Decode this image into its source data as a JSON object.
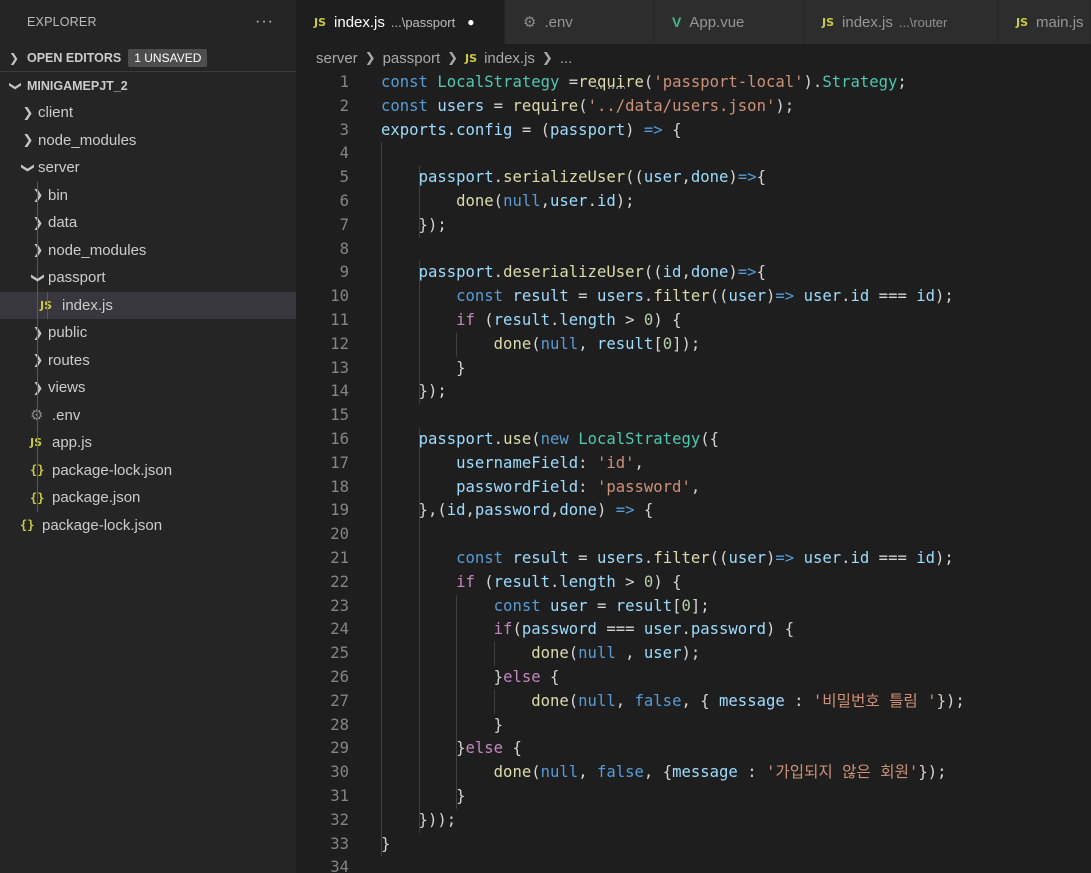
{
  "sidebar": {
    "title": "EXPLORER",
    "more": "···",
    "open_editors": {
      "label": "OPEN EDITORS",
      "badge": "1 UNSAVED"
    },
    "project": {
      "label": "MINIGAMEPJT_2"
    },
    "tree": [
      {
        "label": "client",
        "kind": "folder",
        "depth": 0,
        "expanded": false
      },
      {
        "label": "node_modules",
        "kind": "folder",
        "depth": 0,
        "expanded": false
      },
      {
        "label": "server",
        "kind": "folder",
        "depth": 0,
        "expanded": true
      },
      {
        "label": "bin",
        "kind": "folder",
        "depth": 1,
        "expanded": false
      },
      {
        "label": "data",
        "kind": "folder",
        "depth": 1,
        "expanded": false
      },
      {
        "label": "node_modules",
        "kind": "folder",
        "depth": 1,
        "expanded": false
      },
      {
        "label": "passport",
        "kind": "folder",
        "depth": 1,
        "expanded": true
      },
      {
        "label": "index.js",
        "kind": "js",
        "depth": 2,
        "selected": true
      },
      {
        "label": "public",
        "kind": "folder",
        "depth": 1,
        "expanded": false
      },
      {
        "label": "routes",
        "kind": "folder",
        "depth": 1,
        "expanded": false
      },
      {
        "label": "views",
        "kind": "folder",
        "depth": 1,
        "expanded": false
      },
      {
        "label": ".env",
        "kind": "env",
        "depth": 1
      },
      {
        "label": "app.js",
        "kind": "js",
        "depth": 1
      },
      {
        "label": "package-lock.json",
        "kind": "json",
        "depth": 1
      },
      {
        "label": "package.json",
        "kind": "json",
        "depth": 1
      },
      {
        "label": "package-lock.json",
        "kind": "json",
        "depth": 0
      }
    ]
  },
  "icons": {
    "js": "JS",
    "json": "{}",
    "env": "⚙",
    "vue": "V"
  },
  "tabs": [
    {
      "label": "index.js",
      "desc": "...\\passport",
      "icon": "js",
      "active": true,
      "dirty": true
    },
    {
      "label": ".env",
      "desc": "",
      "icon": "env",
      "active": false
    },
    {
      "label": "App.vue",
      "desc": "",
      "icon": "vue",
      "active": false
    },
    {
      "label": "index.js",
      "desc": "...\\router",
      "icon": "js",
      "active": false
    },
    {
      "label": "main.js",
      "desc": "",
      "icon": "js",
      "active": false
    }
  ],
  "breadcrumb": {
    "parts": [
      "server",
      "passport"
    ],
    "file": "index.js",
    "tail": "..."
  },
  "code_lines": [
    [
      [
        "k",
        "const "
      ],
      [
        "c",
        "LocalStrategy"
      ],
      [
        "p",
        " ="
      ],
      [
        "f",
        "re"
      ],
      [
        "f dots",
        "qui"
      ],
      [
        "f",
        "re"
      ],
      [
        "p",
        "("
      ],
      [
        "s",
        "'passport-local'"
      ],
      [
        "p",
        ")."
      ],
      [
        "c",
        "Strategy"
      ],
      [
        "p",
        ";"
      ]
    ],
    [
      [
        "k",
        "const "
      ],
      [
        "v",
        "users"
      ],
      [
        "p",
        " = "
      ],
      [
        "f",
        "require"
      ],
      [
        "p",
        "("
      ],
      [
        "s",
        "'../data/users.json'"
      ],
      [
        "p",
        ");"
      ]
    ],
    [
      [
        "v",
        "exports"
      ],
      [
        "p",
        "."
      ],
      [
        "v",
        "config"
      ],
      [
        "p",
        " = ("
      ],
      [
        "v",
        "passport"
      ],
      [
        "p",
        ") "
      ],
      [
        "k",
        "=>"
      ],
      [
        "p",
        " {"
      ]
    ],
    [],
    [
      [
        "p",
        "    "
      ],
      [
        "v",
        "passport"
      ],
      [
        "p",
        "."
      ],
      [
        "f",
        "serializeUser"
      ],
      [
        "p",
        "(("
      ],
      [
        "v",
        "user"
      ],
      [
        "p",
        ","
      ],
      [
        "v",
        "done"
      ],
      [
        "p",
        ")"
      ],
      [
        "k",
        "=>"
      ],
      [
        "p",
        "{"
      ]
    ],
    [
      [
        "p",
        "        "
      ],
      [
        "f",
        "done"
      ],
      [
        "p",
        "("
      ],
      [
        "k",
        "null"
      ],
      [
        "p",
        ","
      ],
      [
        "v",
        "user"
      ],
      [
        "p",
        "."
      ],
      [
        "v",
        "id"
      ],
      [
        "p",
        ");"
      ]
    ],
    [
      [
        "p",
        "    });"
      ]
    ],
    [],
    [
      [
        "p",
        "    "
      ],
      [
        "v",
        "passport"
      ],
      [
        "p",
        "."
      ],
      [
        "f",
        "deserializeUser"
      ],
      [
        "p",
        "(("
      ],
      [
        "v",
        "id"
      ],
      [
        "p",
        ","
      ],
      [
        "v",
        "done"
      ],
      [
        "p",
        ")"
      ],
      [
        "k",
        "=>"
      ],
      [
        "p",
        "{"
      ]
    ],
    [
      [
        "p",
        "        "
      ],
      [
        "k",
        "const "
      ],
      [
        "v",
        "result"
      ],
      [
        "p",
        " = "
      ],
      [
        "v",
        "users"
      ],
      [
        "p",
        "."
      ],
      [
        "f",
        "filter"
      ],
      [
        "p",
        "(("
      ],
      [
        "v",
        "user"
      ],
      [
        "p",
        ")"
      ],
      [
        "k",
        "=> "
      ],
      [
        "v",
        "user"
      ],
      [
        "p",
        "."
      ],
      [
        "v",
        "id"
      ],
      [
        "p",
        " === "
      ],
      [
        "v",
        "id"
      ],
      [
        "p",
        ");"
      ]
    ],
    [
      [
        "p",
        "        "
      ],
      [
        "kw",
        "if"
      ],
      [
        "p",
        " ("
      ],
      [
        "v",
        "result"
      ],
      [
        "p",
        "."
      ],
      [
        "v",
        "length"
      ],
      [
        "p",
        " > "
      ],
      [
        "n",
        "0"
      ],
      [
        "p",
        ") {"
      ]
    ],
    [
      [
        "p",
        "            "
      ],
      [
        "f",
        "done"
      ],
      [
        "p",
        "("
      ],
      [
        "k",
        "null"
      ],
      [
        "p",
        ", "
      ],
      [
        "v",
        "result"
      ],
      [
        "p",
        "["
      ],
      [
        "n",
        "0"
      ],
      [
        "p",
        "]);"
      ]
    ],
    [
      [
        "p",
        "        }"
      ]
    ],
    [
      [
        "p",
        "    });"
      ]
    ],
    [],
    [
      [
        "p",
        "    "
      ],
      [
        "v",
        "passport"
      ],
      [
        "p",
        "."
      ],
      [
        "f",
        "use"
      ],
      [
        "p",
        "("
      ],
      [
        "k",
        "new "
      ],
      [
        "c",
        "LocalStrategy"
      ],
      [
        "p",
        "({"
      ]
    ],
    [
      [
        "p",
        "        "
      ],
      [
        "v",
        "usernameField"
      ],
      [
        "p",
        ": "
      ],
      [
        "s",
        "'id'"
      ],
      [
        "p",
        ","
      ]
    ],
    [
      [
        "p",
        "        "
      ],
      [
        "v",
        "passwordField"
      ],
      [
        "p",
        ": "
      ],
      [
        "s",
        "'password'"
      ],
      [
        "p",
        ","
      ]
    ],
    [
      [
        "p",
        "    },("
      ],
      [
        "v",
        "id"
      ],
      [
        "p",
        ","
      ],
      [
        "v",
        "password"
      ],
      [
        "p",
        ","
      ],
      [
        "v",
        "done"
      ],
      [
        "p",
        ") "
      ],
      [
        "k",
        "=>"
      ],
      [
        "p",
        " {"
      ]
    ],
    [],
    [
      [
        "p",
        "        "
      ],
      [
        "k",
        "const "
      ],
      [
        "v",
        "result"
      ],
      [
        "p",
        " = "
      ],
      [
        "v",
        "users"
      ],
      [
        "p",
        "."
      ],
      [
        "f",
        "filter"
      ],
      [
        "p",
        "(("
      ],
      [
        "v",
        "user"
      ],
      [
        "p",
        ")"
      ],
      [
        "k",
        "=> "
      ],
      [
        "v",
        "user"
      ],
      [
        "p",
        "."
      ],
      [
        "v",
        "id"
      ],
      [
        "p",
        " === "
      ],
      [
        "v",
        "id"
      ],
      [
        "p",
        ");"
      ]
    ],
    [
      [
        "p",
        "        "
      ],
      [
        "kw",
        "if"
      ],
      [
        "p",
        " ("
      ],
      [
        "v",
        "result"
      ],
      [
        "p",
        "."
      ],
      [
        "v",
        "length"
      ],
      [
        "p",
        " > "
      ],
      [
        "n",
        "0"
      ],
      [
        "p",
        ") {"
      ]
    ],
    [
      [
        "p",
        "            "
      ],
      [
        "k",
        "const "
      ],
      [
        "v",
        "user"
      ],
      [
        "p",
        " = "
      ],
      [
        "v",
        "result"
      ],
      [
        "p",
        "["
      ],
      [
        "n",
        "0"
      ],
      [
        "p",
        "];"
      ]
    ],
    [
      [
        "p",
        "            "
      ],
      [
        "kw",
        "if"
      ],
      [
        "p",
        "("
      ],
      [
        "v",
        "password"
      ],
      [
        "p",
        " === "
      ],
      [
        "v",
        "user"
      ],
      [
        "p",
        "."
      ],
      [
        "v",
        "password"
      ],
      [
        "p",
        ") {"
      ]
    ],
    [
      [
        "p",
        "                "
      ],
      [
        "f",
        "done"
      ],
      [
        "p",
        "("
      ],
      [
        "k",
        "null"
      ],
      [
        "p",
        " , "
      ],
      [
        "v",
        "user"
      ],
      [
        "p",
        ");"
      ]
    ],
    [
      [
        "p",
        "            }"
      ],
      [
        "kw",
        "else"
      ],
      [
        "p",
        " {"
      ]
    ],
    [
      [
        "p",
        "                "
      ],
      [
        "f",
        "done"
      ],
      [
        "p",
        "("
      ],
      [
        "k",
        "null"
      ],
      [
        "p",
        ", "
      ],
      [
        "k",
        "false"
      ],
      [
        "p",
        ", { "
      ],
      [
        "v",
        "message"
      ],
      [
        "p",
        " : "
      ],
      [
        "s",
        "'비밀번호 틀림 '"
      ],
      [
        "p",
        "});"
      ]
    ],
    [
      [
        "p",
        "            }"
      ]
    ],
    [
      [
        "p",
        "        }"
      ],
      [
        "kw",
        "else"
      ],
      [
        "p",
        " {"
      ]
    ],
    [
      [
        "p",
        "            "
      ],
      [
        "f",
        "done"
      ],
      [
        "p",
        "("
      ],
      [
        "k",
        "null"
      ],
      [
        "p",
        ", "
      ],
      [
        "k",
        "false"
      ],
      [
        "p",
        ", {"
      ],
      [
        "v",
        "message"
      ],
      [
        "p",
        " : "
      ],
      [
        "s",
        "'가입되지 않은 회원'"
      ],
      [
        "p",
        "});"
      ]
    ],
    [
      [
        "p",
        "        }"
      ]
    ],
    [
      [
        "p",
        "    }));"
      ]
    ],
    [
      [
        "p",
        "}"
      ]
    ],
    []
  ],
  "indent_guides": [
    [
      4,
      33,
      1
    ],
    [
      5,
      7,
      2
    ],
    [
      9,
      14,
      2
    ],
    [
      10,
      13,
      2
    ],
    [
      16,
      19,
      2
    ],
    [
      20,
      32,
      2
    ],
    [
      12,
      12,
      3
    ],
    [
      23,
      31,
      3
    ],
    [
      24,
      29,
      3
    ],
    [
      25,
      25,
      4
    ],
    [
      27,
      27,
      4
    ],
    [
      30,
      30,
      3
    ]
  ]
}
